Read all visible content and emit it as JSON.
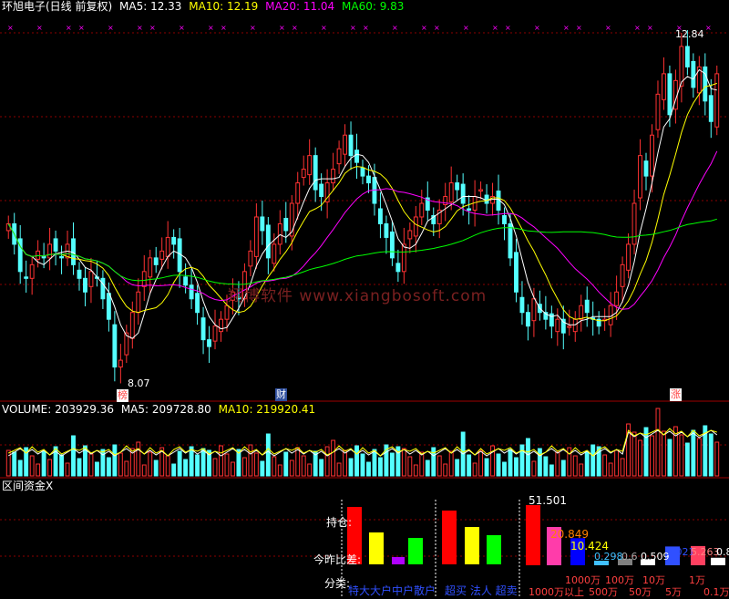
{
  "header": {
    "stock_name": "环旭电子(日线 前复权)",
    "ma5": "MA5: 12.33",
    "ma10": "MA10: 12.19",
    "ma20": "MA20: 11.04",
    "ma60": "MA60: 9.83"
  },
  "colors": {
    "up": "#ff3232",
    "down": "#54ffff",
    "ma5": "#ffffff",
    "ma10": "#ffff00",
    "ma20": "#ff00ff",
    "ma60": "#00ff00",
    "grid": "#8b0000",
    "volLabel": "#ffffff"
  },
  "price_panel": {
    "high_label": "12.84",
    "low_label": "8.07",
    "markers": [
      "榜",
      "财",
      "涨"
    ],
    "watermark": "翔博软件 www.xiangbosoft.com"
  },
  "volume_panel": {
    "volume": "VOLUME: 203929.36",
    "ma5": "MA5: 209728.80",
    "ma10": "MA10: 219920.41"
  },
  "fund_panel": {
    "title": "区间资金X",
    "label_hold": "持仓:",
    "label_diff": "今昨比差:",
    "label_class": "分类:",
    "classes_a": "特大大户中户散户",
    "classes_b": "超买 法人 超卖",
    "values": [
      "51.501",
      "20.849",
      "10.424",
      "0.298",
      "0.6",
      "0.509",
      "5.021",
      "5.263",
      "0.8"
    ],
    "ranges_top": [
      "1000万",
      "100万",
      "10万",
      "1万"
    ],
    "ranges_bot": [
      "1000万以上",
      "500万",
      "50万",
      "5万",
      "0.1万"
    ]
  },
  "chart_data": [
    {
      "type": "candlestick",
      "title": "环旭电子(日线 前复权)",
      "series": [
        {
          "name": "MA5",
          "last": 12.33
        },
        {
          "name": "MA10",
          "last": 12.19
        },
        {
          "name": "MA20",
          "last": 11.04
        },
        {
          "name": "MA60",
          "last": 9.83
        }
      ],
      "ylim": [
        7.9,
        13.1
      ],
      "annotations": [
        {
          "text": "12.84",
          "value": 12.84
        },
        {
          "text": "8.07",
          "value": 8.07
        }
      ],
      "close": [
        10.3,
        10.0,
        9.6,
        9.5,
        9.7,
        9.9,
        9.8,
        10.0,
        9.9,
        9.8,
        10.0,
        9.7,
        9.5,
        9.3,
        9.6,
        9.5,
        9.2,
        8.9,
        8.2,
        8.3,
        8.7,
        9.0,
        9.3,
        9.6,
        9.8,
        9.7,
        9.9,
        10.1,
        10.0,
        9.6,
        9.4,
        9.2,
        9.0,
        8.6,
        8.5,
        8.8,
        8.9,
        9.1,
        9.3,
        9.2,
        9.6,
        9.9,
        10.4,
        10.2,
        9.8,
        10.0,
        10.3,
        10.2,
        10.6,
        10.9,
        11.1,
        11.3,
        10.8,
        10.7,
        10.9,
        11.1,
        11.4,
        11.6,
        11.3,
        11.2,
        11.0,
        10.9,
        10.6,
        10.3,
        10.1,
        9.8,
        9.6,
        10.0,
        10.2,
        10.4,
        10.6,
        10.5,
        10.3,
        10.5,
        10.7,
        10.9,
        10.8,
        10.6,
        10.5,
        10.7,
        10.8,
        10.6,
        10.7,
        10.5,
        10.3,
        9.8,
        9.3,
        9.0,
        8.8,
        9.2,
        9.0,
        8.9,
        8.8,
        8.9,
        8.7,
        8.8,
        8.9,
        9.1,
        9.0,
        8.9,
        8.8,
        8.9,
        9.1,
        9.3,
        9.7,
        10.0,
        10.6,
        11.3,
        11.0,
        11.6,
        12.2,
        12.5,
        11.9,
        12.4,
        12.9,
        12.6,
        12.3,
        12.6,
        12.1,
        11.8,
        12.5
      ],
      "volume_current": 203929.36,
      "volume_ma5": 209728.8,
      "volume_ma10": 219920.41
    },
    {
      "type": "bar",
      "title": "区间资金X",
      "categories": [
        "特大",
        "大户",
        "中户",
        "散户",
        "超买",
        "法人",
        "超卖",
        "1000万以上",
        "500万",
        "50万",
        "5万",
        "0.1万"
      ],
      "values": [
        51.501,
        20.849,
        10.424,
        0.298,
        0.6,
        0.509,
        5.021,
        5.263,
        0.8
      ]
    }
  ]
}
